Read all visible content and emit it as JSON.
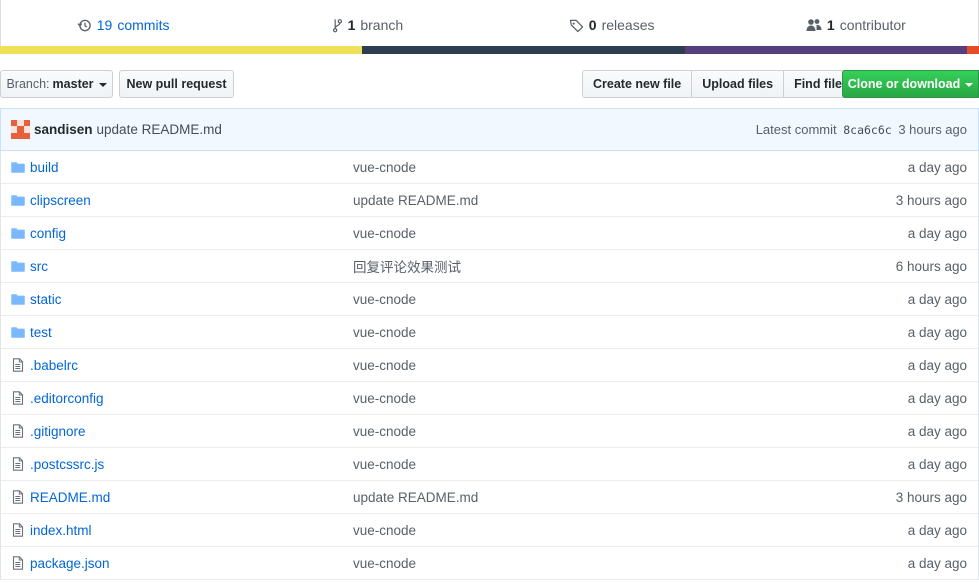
{
  "summary": {
    "commits": {
      "count": "19",
      "label": "commits",
      "icon": "history-icon"
    },
    "branches": {
      "count": "1",
      "label": "branch",
      "icon": "branch-icon"
    },
    "releases": {
      "count": "0",
      "label": "releases",
      "icon": "tag-icon"
    },
    "contributors": {
      "count": "1",
      "label": "contributor",
      "icon": "people-icon"
    }
  },
  "languages": [
    {
      "color": "#f1e05a",
      "percent": 37
    },
    {
      "color": "#2c3e50",
      "percent": 33
    },
    {
      "color": "#563d7c",
      "percent": 28.8
    },
    {
      "color": "#e34c26",
      "percent": 1.2
    }
  ],
  "toolbar": {
    "branch_prefix": "Branch:",
    "branch_name": "master",
    "new_pull_request": "New pull request",
    "create_new_file": "Create new file",
    "upload_files": "Upload files",
    "find_file": "Find file",
    "clone_or_download": "Clone or download"
  },
  "commit": {
    "author": "sandisen",
    "message": "update README.md",
    "latest_label": "Latest commit",
    "sha": "8ca6c6c",
    "time": "3 hours ago"
  },
  "files": [
    {
      "type": "dir",
      "name": "build",
      "message": "vue-cnode",
      "age": "a day ago"
    },
    {
      "type": "dir",
      "name": "clipscreen",
      "message": "update README.md",
      "age": "3 hours ago"
    },
    {
      "type": "dir",
      "name": "config",
      "message": "vue-cnode",
      "age": "a day ago"
    },
    {
      "type": "dir",
      "name": "src",
      "message": "回复评论效果测试",
      "age": "6 hours ago"
    },
    {
      "type": "dir",
      "name": "static",
      "message": "vue-cnode",
      "age": "a day ago"
    },
    {
      "type": "dir",
      "name": "test",
      "message": "vue-cnode",
      "age": "a day ago"
    },
    {
      "type": "file",
      "name": ".babelrc",
      "message": "vue-cnode",
      "age": "a day ago"
    },
    {
      "type": "file",
      "name": ".editorconfig",
      "message": "vue-cnode",
      "age": "a day ago"
    },
    {
      "type": "file",
      "name": ".gitignore",
      "message": "vue-cnode",
      "age": "a day ago"
    },
    {
      "type": "file",
      "name": ".postcssrc.js",
      "message": "vue-cnode",
      "age": "a day ago"
    },
    {
      "type": "file",
      "name": "README.md",
      "message": "update README.md",
      "age": "3 hours ago"
    },
    {
      "type": "file",
      "name": "index.html",
      "message": "vue-cnode",
      "age": "a day ago"
    },
    {
      "type": "file",
      "name": "package.json",
      "message": "vue-cnode",
      "age": "a day ago"
    }
  ]
}
